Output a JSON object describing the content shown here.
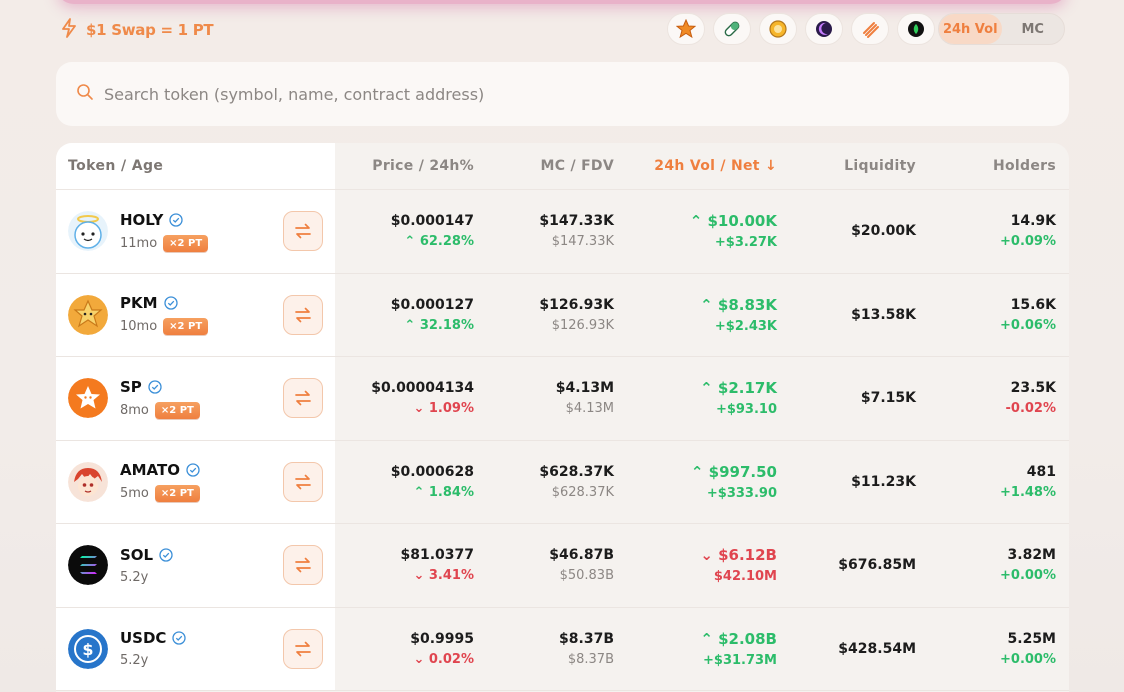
{
  "promo": {
    "icon": "bolt-icon",
    "text": "$1 Swap = 1 PT"
  },
  "chips": [
    "star-token-icon",
    "pill-token-icon",
    "coin-token-icon",
    "moon-token-icon",
    "stripes-token-icon",
    "green-token-icon"
  ],
  "toggle": {
    "options": [
      "24h Vol",
      "MC"
    ],
    "active": "24h Vol"
  },
  "search": {
    "placeholder": "Search token (symbol, name, contract address)",
    "value": ""
  },
  "table": {
    "headers": {
      "token": "Token / Age",
      "price": "Price / 24h%",
      "mc": "MC / FDV",
      "vol": "24h Vol / Net",
      "vol_sort": "↓",
      "liquidity": "Liquidity",
      "holders": "Holders"
    },
    "rows": [
      {
        "symbol": "HOLY",
        "age": "11mo",
        "badge": "×2 PT",
        "price": "$0.000147",
        "change": "62.28%",
        "change_dir": "up",
        "mc": "$147.33K",
        "fdv": "$147.33K",
        "vol": "$10.00K",
        "vol_dir": "up",
        "net": "+$3.27K",
        "net_dir": "up",
        "liquidity": "$20.00K",
        "holders": "14.9K",
        "holders_change": "+0.09%",
        "holders_dir": "up"
      },
      {
        "symbol": "PKM",
        "age": "10mo",
        "badge": "×2 PT",
        "price": "$0.000127",
        "change": "32.18%",
        "change_dir": "up",
        "mc": "$126.93K",
        "fdv": "$126.93K",
        "vol": "$8.83K",
        "vol_dir": "up",
        "net": "+$2.43K",
        "net_dir": "up",
        "liquidity": "$13.58K",
        "holders": "15.6K",
        "holders_change": "+0.06%",
        "holders_dir": "up"
      },
      {
        "symbol": "SP",
        "age": "8mo",
        "badge": "×2 PT",
        "price": "$0.00004134",
        "change": "1.09%",
        "change_dir": "down",
        "mc": "$4.13M",
        "fdv": "$4.13M",
        "vol": "$2.17K",
        "vol_dir": "up",
        "net": "+$93.10",
        "net_dir": "up",
        "liquidity": "$7.15K",
        "holders": "23.5K",
        "holders_change": "-0.02%",
        "holders_dir": "down"
      },
      {
        "symbol": "AMATO",
        "age": "5mo",
        "badge": "×2 PT",
        "price": "$0.000628",
        "change": "1.84%",
        "change_dir": "up",
        "mc": "$628.37K",
        "fdv": "$628.37K",
        "vol": "$997.50",
        "vol_dir": "up",
        "net": "+$333.90",
        "net_dir": "up",
        "liquidity": "$11.23K",
        "holders": "481",
        "holders_change": "+1.48%",
        "holders_dir": "up"
      },
      {
        "symbol": "SOL",
        "age": "5.2y",
        "badge": "",
        "price": "$81.0377",
        "change": "3.41%",
        "change_dir": "down",
        "mc": "$46.87B",
        "fdv": "$50.83B",
        "vol": "$6.12B",
        "vol_dir": "down",
        "net": "$42.10M",
        "net_dir": "down",
        "liquidity": "$676.85M",
        "holders": "3.82M",
        "holders_change": "+0.00%",
        "holders_dir": "up"
      },
      {
        "symbol": "USDC",
        "age": "5.2y",
        "badge": "",
        "price": "$0.9995",
        "change": "0.02%",
        "change_dir": "down",
        "mc": "$8.37B",
        "fdv": "$8.37B",
        "vol": "$2.08B",
        "vol_dir": "up",
        "net": "+$31.73M",
        "net_dir": "up",
        "liquidity": "$428.54M",
        "holders": "5.25M",
        "holders_change": "+0.00%",
        "holders_dir": "up"
      }
    ]
  },
  "colors": {
    "accent": "#ef7f3f",
    "up": "#2cbc6a",
    "down": "#e0454f"
  }
}
